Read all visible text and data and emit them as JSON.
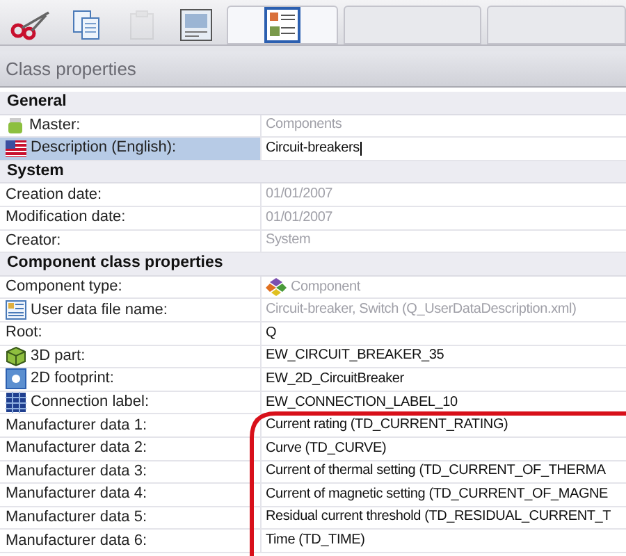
{
  "toolbar": [
    {
      "kind": "scissors",
      "disabled": false,
      "selected": false
    },
    {
      "kind": "copy",
      "disabled": false,
      "selected": false
    },
    {
      "kind": "paste",
      "disabled": true,
      "selected": false
    },
    {
      "kind": "form",
      "disabled": false,
      "selected": false
    },
    {
      "kind": "properties",
      "disabled": false,
      "selected": true
    },
    {
      "kind": "blank",
      "disabled": false,
      "selected": false
    },
    {
      "kind": "blank",
      "disabled": false,
      "selected": false
    }
  ],
  "panel": {
    "title": "Class properties"
  },
  "rows": [
    {
      "kind": "section",
      "label": "General"
    },
    {
      "kind": "jar",
      "label": "Master:",
      "value": "Components",
      "readonly": true,
      "selected": false
    },
    {
      "kind": "flag",
      "label": "Description (English):",
      "value": "Circuit-breakers",
      "readonly": false,
      "selected": true,
      "editing": true
    },
    {
      "kind": "section",
      "label": "System"
    },
    {
      "kind": "plain",
      "label": "Creation date:",
      "value": "01/01/2007",
      "readonly": true,
      "selected": false
    },
    {
      "kind": "plain",
      "label": "Modification date:",
      "value": "01/01/2007",
      "readonly": true,
      "selected": false
    },
    {
      "kind": "plain",
      "label": "Creator:",
      "value": "System",
      "readonly": true,
      "selected": false
    },
    {
      "kind": "section",
      "label": "Component class properties"
    },
    {
      "kind": "plain",
      "label": "Component type:",
      "value": "Component",
      "readonly": true,
      "selected": false,
      "value_icon": true
    },
    {
      "kind": "file",
      "label": "User data file name:",
      "value": "Circuit-breaker, Switch (Q_UserDataDescription.xml)",
      "readonly": true,
      "selected": false
    },
    {
      "kind": "plain",
      "label": "Root:",
      "value": "Q",
      "readonly": false,
      "selected": false
    },
    {
      "kind": "cube",
      "label": "3D part:",
      "value": "EW_CIRCUIT_BREAKER_35",
      "readonly": false,
      "selected": false
    },
    {
      "kind": "footprint",
      "label": "2D footprint:",
      "value": "EW_2D_CircuitBreaker",
      "readonly": false,
      "selected": false
    },
    {
      "kind": "grid",
      "label": "Connection label:",
      "value": "EW_CONNECTION_LABEL_10",
      "readonly": false,
      "selected": false
    },
    {
      "kind": "plain",
      "label": "Manufacturer data 1:",
      "value": "Current rating (TD_CURRENT_RATING)",
      "readonly": false,
      "selected": false
    },
    {
      "kind": "plain",
      "label": "Manufacturer data 2:",
      "value": "Curve (TD_CURVE)",
      "readonly": false,
      "selected": false
    },
    {
      "kind": "plain",
      "label": "Manufacturer data 3:",
      "value": "Current of thermal setting (TD_CURRENT_OF_THERMA",
      "readonly": false,
      "selected": false
    },
    {
      "kind": "plain",
      "label": "Manufacturer data 4:",
      "value": "Current of magnetic setting (TD_CURRENT_OF_MAGNE",
      "readonly": false,
      "selected": false
    },
    {
      "kind": "plain",
      "label": "Manufacturer data 5:",
      "value": "Residual current threshold (TD_RESIDUAL_CURRENT_T",
      "readonly": false,
      "selected": false
    },
    {
      "kind": "plain",
      "label": "Manufacturer data 6:",
      "value": "Time (TD_TIME)",
      "readonly": false,
      "selected": false
    }
  ]
}
